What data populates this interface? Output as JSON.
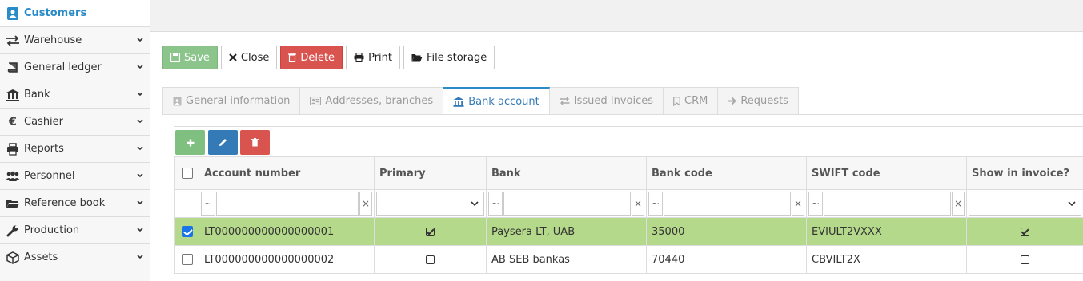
{
  "sidebar": {
    "items": [
      {
        "label": "Customers",
        "icon": "customer-icon",
        "active": true
      },
      {
        "label": "Warehouse",
        "icon": "arrows-icon"
      },
      {
        "label": "General ledger",
        "icon": "book-icon"
      },
      {
        "label": "Bank",
        "icon": "bank-icon"
      },
      {
        "label": "Cashier",
        "icon": "euro-icon"
      },
      {
        "label": "Reports",
        "icon": "printer-icon"
      },
      {
        "label": "Personnel",
        "icon": "users-icon"
      },
      {
        "label": "Reference book",
        "icon": "folder-icon"
      },
      {
        "label": "Production",
        "icon": "wrench-icon"
      },
      {
        "label": "Assets",
        "icon": "cube-icon"
      }
    ]
  },
  "toolbar": {
    "save": "Save",
    "close": "Close",
    "delete": "Delete",
    "print": "Print",
    "file_storage": "File storage"
  },
  "tabs": [
    {
      "label": "General information",
      "icon": "id-card-icon"
    },
    {
      "label": "Addresses, branches",
      "icon": "address-card-icon"
    },
    {
      "label": "Bank account",
      "icon": "bank-icon",
      "active": true
    },
    {
      "label": "Issued Invoices",
      "icon": "exchange-icon"
    },
    {
      "label": "CRM",
      "icon": "bookmark-icon"
    },
    {
      "label": "Requests",
      "icon": "arrow-right-icon"
    }
  ],
  "grid": {
    "columns": [
      "Account number",
      "Primary",
      "Bank",
      "Bank code",
      "SWIFT code",
      "Show in invoice?"
    ],
    "filter_tilde": "~",
    "filter_clear": "×",
    "rows": [
      {
        "account": "LT000000000000000001",
        "primary": true,
        "bank": "Paysera LT, UAB",
        "code": "35000",
        "swift": "EVIULT2VXXX",
        "show": true,
        "selected": true
      },
      {
        "account": "LT000000000000000002",
        "primary": false,
        "bank": "AB SEB bankas",
        "code": "70440",
        "swift": "CBVILT2X",
        "show": false,
        "selected": false
      }
    ]
  },
  "colors": {
    "accent": "#2a8bc9",
    "save": "#8cc58c",
    "delete": "#d9534f",
    "selected_row": "#b5d98a"
  }
}
